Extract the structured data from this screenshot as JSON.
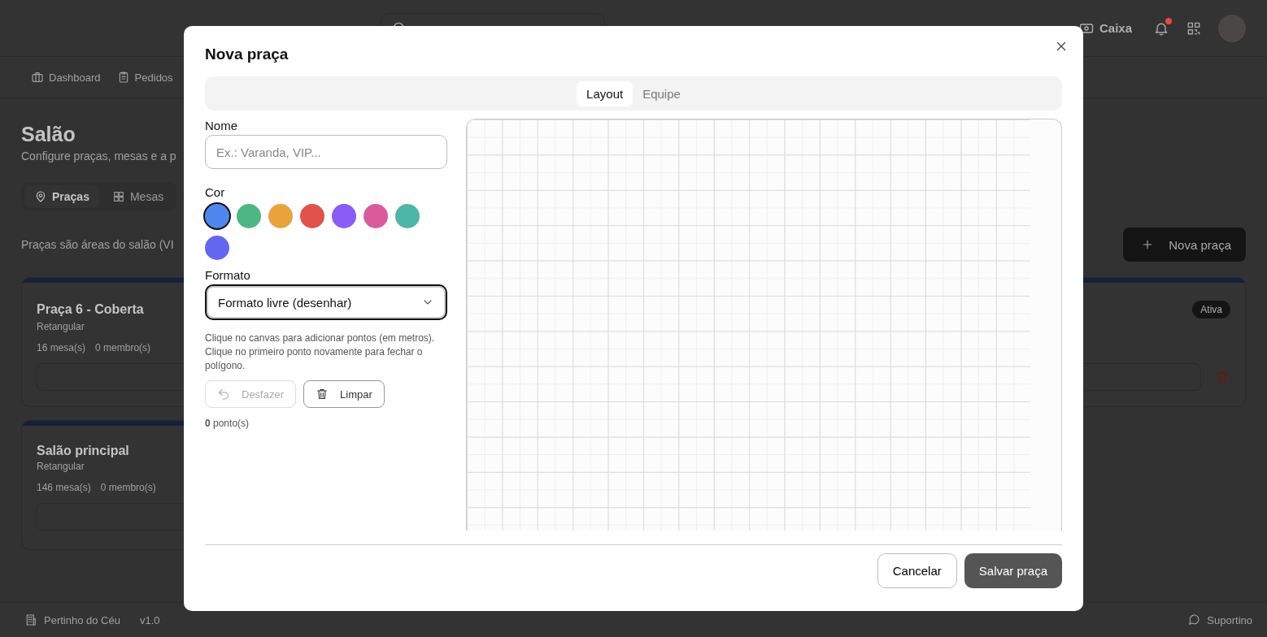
{
  "header": {
    "cash_label": "Caixa",
    "has_notification": true
  },
  "nav": [
    {
      "label": "Dashboard",
      "kind": "dashboard"
    },
    {
      "label": "Pedidos",
      "kind": "orders"
    }
  ],
  "page": {
    "title": "Salão",
    "subtitle": "Configure praças, mesas e a p",
    "tabs": [
      {
        "label": "Praças",
        "kind": "pin",
        "selected": true
      },
      {
        "label": "Mesas",
        "kind": "grid",
        "selected": false
      }
    ],
    "description": "Praças são áreas do salão (VI",
    "new_button": "Nova praça",
    "areas": [
      {
        "name": "Praça 6 - Coberta",
        "shape": "Retangular",
        "tables": "16 mesa(s)",
        "members": "0 membro(s)",
        "status": "Ativa"
      },
      {
        "name": "Salão principal",
        "shape": "Retangular",
        "tables": "146 mesa(s)",
        "members": "0 membro(s)"
      }
    ]
  },
  "footer": {
    "brand": "Pertinho do Céu",
    "version": "v1.0",
    "support": "Suportino"
  },
  "dialog": {
    "title": "Nova praça",
    "tabs": [
      {
        "label": "Layout",
        "selected": true
      },
      {
        "label": "Equipe",
        "selected": false
      }
    ],
    "name_label": "Nome",
    "name_placeholder": "Ex.: Varanda, VIP...",
    "color_label": "Cor",
    "colors": [
      {
        "color": "#4f86f0",
        "selected": true
      },
      {
        "color": "#4cb782",
        "selected": false
      },
      {
        "color": "#e8a33d",
        "selected": false
      },
      {
        "color": "#e0524a",
        "selected": false
      },
      {
        "color": "#8b5cf6",
        "selected": false
      },
      {
        "color": "#db5a9c",
        "selected": false
      },
      {
        "color": "#4db6a6",
        "selected": false
      },
      {
        "color": "#6366f1",
        "selected": false
      }
    ],
    "shape_label": "Formato",
    "shape_value": "Formato livre (desenhar)",
    "hint": "Clique no canvas para adicionar pontos (em metros). Clique no primeiro ponto novamente para fechar o polígono.",
    "undo": {
      "label": "Desfazer",
      "disabled": true
    },
    "clear": {
      "label": "Limpar",
      "disabled": false
    },
    "points": "**0** ponto(s)",
    "cancel": "Cancelar",
    "save": "Salvar praça"
  }
}
